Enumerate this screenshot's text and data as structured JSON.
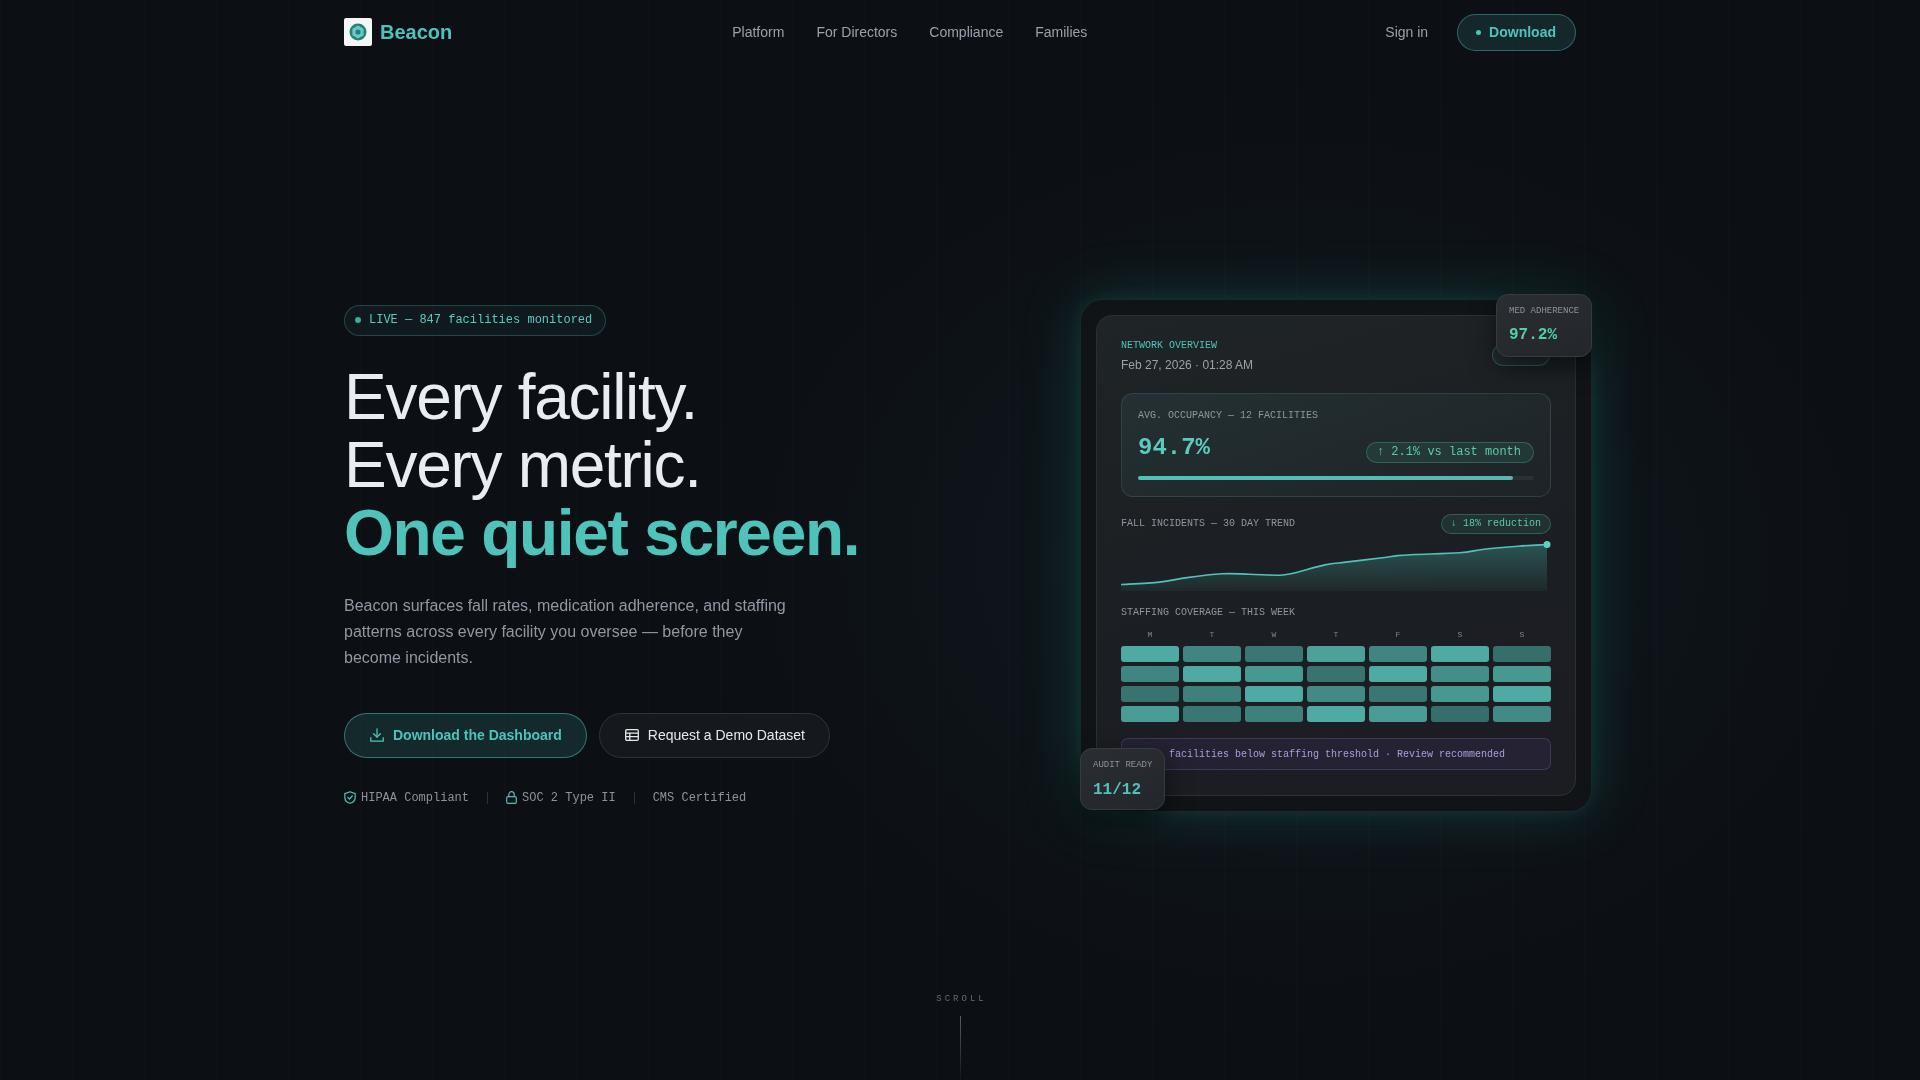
{
  "nav": {
    "brand": "Beacon",
    "links": [
      {
        "label": "Platform"
      },
      {
        "label": "For Directors"
      },
      {
        "label": "Compliance"
      },
      {
        "label": "Families"
      }
    ],
    "sign_in": "Sign in",
    "download": "Download"
  },
  "hero": {
    "badge": "LIVE — 847 facilities monitored",
    "headline": [
      {
        "text": "Every facility.",
        "kind": "plain"
      },
      {
        "text": "Every metric.",
        "kind": "plain"
      },
      {
        "text": "One quiet screen.",
        "kind": "accent"
      }
    ],
    "description": "Beacon surfaces fall rates, medication adherence, and staffing patterns across every facility you oversee — before they become incidents.",
    "buttons": [
      {
        "label": "Download the Dashboard",
        "kind": "primary"
      },
      {
        "label": "Request a Demo Dataset",
        "kind": "secondary"
      }
    ],
    "trust": [
      {
        "label": "HIPAA Compliant",
        "kind": "shield"
      },
      {
        "label": "SOC 2 Type II",
        "kind": "lock"
      },
      {
        "label": "CMS Certified",
        "kind": "plain"
      }
    ]
  },
  "dashboard": {
    "title": "NETWORK OVERVIEW",
    "timestamp": "Feb 27, 2026 · 01:28 AM",
    "occupancy": {
      "label": "AVG. OCCUPANCY — 12 FACILITIES",
      "value": "94.7%",
      "change": "↑ 2.1% vs last month",
      "level": 0.947
    },
    "falls": {
      "label": "FALL INCIDENTS — 30 DAY TREND",
      "change": "↓ 18% reduction"
    },
    "staffing": {
      "label": "STAFFING COVERAGE — THIS WEEK",
      "days": [
        "M",
        "T",
        "W",
        "T",
        "F",
        "S",
        "S"
      ],
      "rows": [
        {
          "cells": [
            {
              "color": "#50aaa4"
            },
            {
              "color": "#408581"
            },
            {
              "color": "#3a7774"
            },
            {
              "color": "#4ca19b"
            },
            {
              "color": "#408581"
            },
            {
              "color": "#50aaa4"
            },
            {
              "color": "#366e6b"
            }
          ]
        },
        {
          "cells": [
            {
              "color": "#408581"
            },
            {
              "color": "#50aaa4"
            },
            {
              "color": "#489892"
            },
            {
              "color": "#38736f"
            },
            {
              "color": "#50aaa4"
            },
            {
              "color": "#448e8a"
            },
            {
              "color": "#489892"
            }
          ]
        },
        {
          "cells": [
            {
              "color": "#38736f"
            },
            {
              "color": "#3e817c"
            },
            {
              "color": "#50aaa4"
            },
            {
              "color": "#428a85"
            },
            {
              "color": "#3a7774"
            },
            {
              "color": "#489892"
            },
            {
              "color": "#50aaa4"
            }
          ]
        },
        {
          "cells": [
            {
              "color": "#4a9c97"
            },
            {
              "color": "#3a7774"
            },
            {
              "color": "#3e817c"
            },
            {
              "color": "#50aaa4"
            },
            {
              "color": "#4a9c97"
            },
            {
              "color": "#366e6b"
            },
            {
              "color": "#428a85"
            }
          ]
        }
      ]
    },
    "alert": "facilities below staffing threshold · Review recommended",
    "floating_cards": [
      {
        "label": "MED ADHERENCE",
        "value": "97.2%"
      },
      {
        "label": "AUDIT READY",
        "value": "11/12"
      }
    ]
  },
  "scroll_hint": "SCROLL"
}
